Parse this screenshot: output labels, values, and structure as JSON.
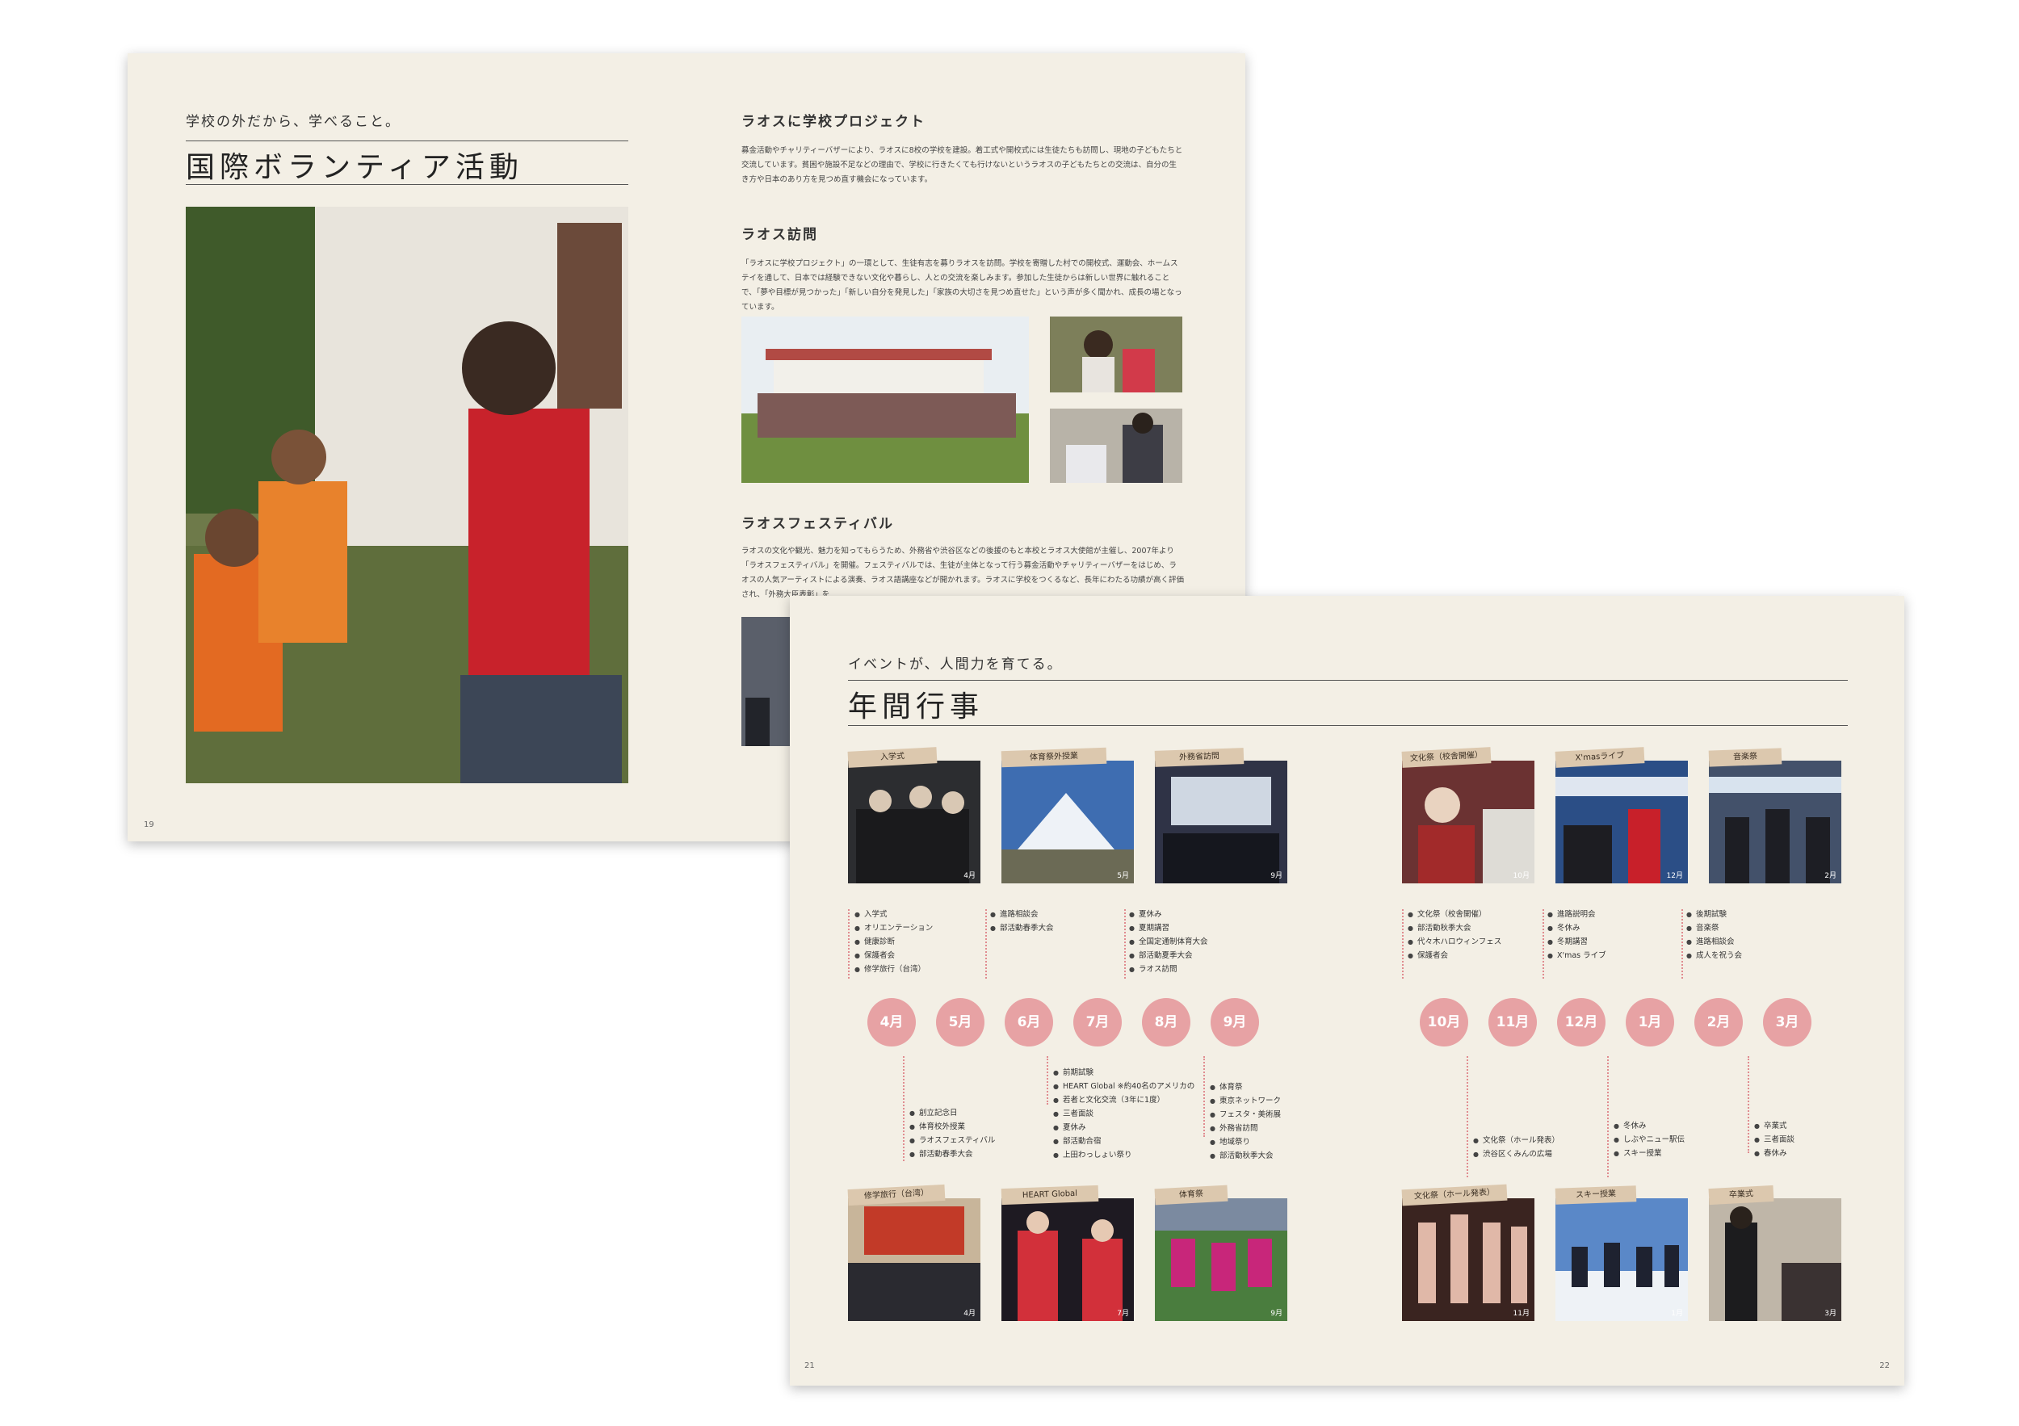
{
  "back_page": {
    "tagline": "学校の外だから、学べること。",
    "title": "国際ボランティア活動",
    "page_number": "19",
    "sections": [
      {
        "heading": "ラオスに学校プロジェクト",
        "body": "募金活動やチャリティーバザーにより、ラオスに8校の学校を建設。着工式や開校式には生徒たちも訪問し、現地の子どもたちと交流しています。貧困や施設不足などの理由で、学校に行きたくても行けないというラオスの子どもたちとの交流は、自分の生き方や日本のあり方を見つめ直す機会になっています。"
      },
      {
        "heading": "ラオス訪問",
        "body": "「ラオスに学校プロジェクト」の一環として、生徒有志を募りラオスを訪問。学校を寄贈した村での開校式、運動会、ホームステイを通して、日本では経験できない文化や暮らし、人との交流を楽しみます。参加した生徒からは新しい世界に触れることで、「夢や目標が見つかった」「新しい自分を発見した」「家族の大切さを見つめ直せた」という声が多く聞かれ、成長の場となっています。"
      },
      {
        "heading": "ラオスフェスティバル",
        "body": "ラオスの文化や観光、魅力を知ってもらうため、外務省や渋谷区などの後援のもと本校とラオス大使館が主催し、2007年より「ラオスフェスティバル」を開催。フェスティバルでは、生徒が主体となって行う募金活動やチャリティーバザーをはじめ、ラオスの人気アーティストによる演奏、ラオス語講座などが開かれます。ラオスに学校をつくるなど、長年にわたる功績が高く評価され、「外務大臣表彰」を"
      }
    ]
  },
  "front_page": {
    "tagline": "イベントが、人間力を育てる。",
    "title": "年間行事",
    "page_left": "21",
    "page_right": "22",
    "top_events": [
      {
        "label": "入学式",
        "month": "4月",
        "items": [
          "入学式",
          "オリエンテーション",
          "健康診断",
          "保護者会",
          "修学旅行（台湾）"
        ]
      },
      {
        "label": "体育祭外授業",
        "month": "5月",
        "items": [
          "進路相談会",
          "部活動春季大会"
        ]
      },
      {
        "label": "外務省訪問",
        "month": "9月",
        "items": [
          "夏休み",
          "夏期講習",
          "全国定通制体育大会",
          "部活動夏季大会",
          "ラオス訪問"
        ]
      },
      {
        "label": "文化祭（校舎開催）",
        "month": "10月",
        "items": [
          "文化祭（校舎開催）",
          "部活動秋季大会",
          "代々木ハロウィンフェス",
          "保護者会"
        ]
      },
      {
        "label": "X'masライブ",
        "month": "12月",
        "items": [
          "進路説明会",
          "冬休み",
          "冬期講習",
          "X'mas ライブ"
        ]
      },
      {
        "label": "音楽祭",
        "month": "2月",
        "items": [
          "後期試験",
          "音楽祭",
          "進路相談会",
          "成人を祝う会"
        ]
      }
    ],
    "months": [
      "4月",
      "5月",
      "6月",
      "7月",
      "8月",
      "9月",
      "10月",
      "11月",
      "12月",
      "1月",
      "2月",
      "3月"
    ],
    "bottom_lists": [
      {
        "items": [
          "創立記念日",
          "体育校外授業",
          "ラオスフェスティバル",
          "部活動春季大会"
        ]
      },
      {
        "items": [
          "前期試験",
          "HEART Global ※約40名のアメリカの",
          "若者と文化交流（3年に1度）",
          "三者面談",
          "夏休み",
          "部活動合宿",
          "上田わっしょい祭り"
        ]
      },
      {
        "items": [
          "体育祭",
          "東京ネットワーク",
          "フェスタ・美術展",
          "外務省訪問",
          "地域祭り",
          "部活動秋季大会"
        ]
      },
      {
        "items": [
          "文化祭（ホール発表）",
          "渋谷区くみんの広場"
        ]
      },
      {
        "items": [
          "冬休み",
          "しぶやニュー駅伝",
          "スキー授業"
        ]
      },
      {
        "items": [
          "卒業式",
          "三者面談",
          "春休み"
        ]
      }
    ],
    "bottom_events": [
      {
        "label": "修学旅行（台湾）",
        "month": "4月"
      },
      {
        "label": "HEART Global",
        "month": "7月"
      },
      {
        "label": "体育祭",
        "month": "9月"
      },
      {
        "label": "文化祭（ホール発表）",
        "month": "11月"
      },
      {
        "label": "スキー授業",
        "month": "1月"
      },
      {
        "label": "卒業式",
        "month": "3月"
      }
    ]
  },
  "colors": {
    "page_bg": "#f3efe5",
    "month_circle": "#e7a2a4",
    "tag_bg": "#dcc8ae",
    "dotted_line": "#e08c90"
  }
}
